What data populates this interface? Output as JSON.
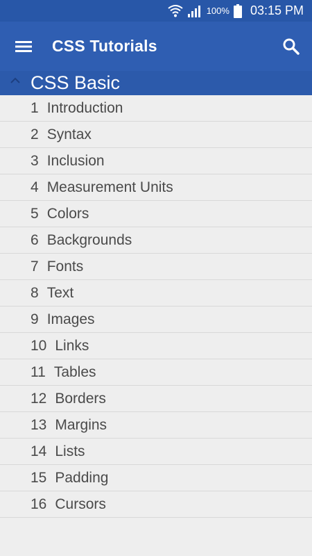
{
  "status_bar": {
    "battery_percent": "100%",
    "time": "03:15 PM"
  },
  "app_bar": {
    "title": "CSS Tutorials"
  },
  "section": {
    "title": "CSS Basic",
    "expanded": true
  },
  "lessons": [
    {
      "num": "1",
      "title": "Introduction"
    },
    {
      "num": "2",
      "title": "Syntax"
    },
    {
      "num": "3",
      "title": "Inclusion"
    },
    {
      "num": "4",
      "title": "Measurement Units"
    },
    {
      "num": "5",
      "title": "Colors"
    },
    {
      "num": "6",
      "title": "Backgrounds"
    },
    {
      "num": "7",
      "title": "Fonts"
    },
    {
      "num": "8",
      "title": "Text"
    },
    {
      "num": "9",
      "title": "Images"
    },
    {
      "num": "10",
      "title": "Links"
    },
    {
      "num": "11",
      "title": "Tables"
    },
    {
      "num": "12",
      "title": "Borders"
    },
    {
      "num": "13",
      "title": "Margins"
    },
    {
      "num": "14",
      "title": "Lists"
    },
    {
      "num": "15",
      "title": "Padding"
    },
    {
      "num": "16",
      "title": "Cursors"
    }
  ],
  "icons": {
    "menu": "hamburger-menu-icon",
    "search": "search-icon",
    "section_toggle": "chevron-up-icon",
    "wifi": "wifi-icon",
    "signal": "signal-icon",
    "battery": "battery-icon"
  },
  "colors": {
    "status_bar": "#2857a8",
    "app_bar": "#2f5eb2",
    "section_header": "#2c5aab",
    "background": "#eeeeee",
    "item_text": "#4a4a4a"
  }
}
